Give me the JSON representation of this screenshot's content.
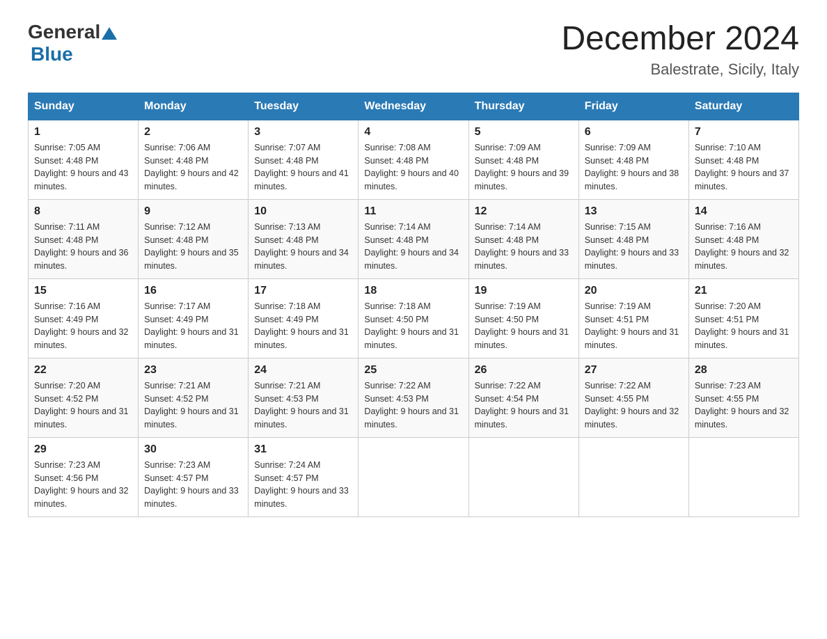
{
  "header": {
    "logo_general": "General",
    "logo_blue": "Blue",
    "month_title": "December 2024",
    "location": "Balestrate, Sicily, Italy"
  },
  "days_of_week": [
    "Sunday",
    "Monday",
    "Tuesday",
    "Wednesday",
    "Thursday",
    "Friday",
    "Saturday"
  ],
  "weeks": [
    [
      {
        "day": "1",
        "sunrise": "7:05 AM",
        "sunset": "4:48 PM",
        "daylight": "9 hours and 43 minutes."
      },
      {
        "day": "2",
        "sunrise": "7:06 AM",
        "sunset": "4:48 PM",
        "daylight": "9 hours and 42 minutes."
      },
      {
        "day": "3",
        "sunrise": "7:07 AM",
        "sunset": "4:48 PM",
        "daylight": "9 hours and 41 minutes."
      },
      {
        "day": "4",
        "sunrise": "7:08 AM",
        "sunset": "4:48 PM",
        "daylight": "9 hours and 40 minutes."
      },
      {
        "day": "5",
        "sunrise": "7:09 AM",
        "sunset": "4:48 PM",
        "daylight": "9 hours and 39 minutes."
      },
      {
        "day": "6",
        "sunrise": "7:09 AM",
        "sunset": "4:48 PM",
        "daylight": "9 hours and 38 minutes."
      },
      {
        "day": "7",
        "sunrise": "7:10 AM",
        "sunset": "4:48 PM",
        "daylight": "9 hours and 37 minutes."
      }
    ],
    [
      {
        "day": "8",
        "sunrise": "7:11 AM",
        "sunset": "4:48 PM",
        "daylight": "9 hours and 36 minutes."
      },
      {
        "day": "9",
        "sunrise": "7:12 AM",
        "sunset": "4:48 PM",
        "daylight": "9 hours and 35 minutes."
      },
      {
        "day": "10",
        "sunrise": "7:13 AM",
        "sunset": "4:48 PM",
        "daylight": "9 hours and 34 minutes."
      },
      {
        "day": "11",
        "sunrise": "7:14 AM",
        "sunset": "4:48 PM",
        "daylight": "9 hours and 34 minutes."
      },
      {
        "day": "12",
        "sunrise": "7:14 AM",
        "sunset": "4:48 PM",
        "daylight": "9 hours and 33 minutes."
      },
      {
        "day": "13",
        "sunrise": "7:15 AM",
        "sunset": "4:48 PM",
        "daylight": "9 hours and 33 minutes."
      },
      {
        "day": "14",
        "sunrise": "7:16 AM",
        "sunset": "4:48 PM",
        "daylight": "9 hours and 32 minutes."
      }
    ],
    [
      {
        "day": "15",
        "sunrise": "7:16 AM",
        "sunset": "4:49 PM",
        "daylight": "9 hours and 32 minutes."
      },
      {
        "day": "16",
        "sunrise": "7:17 AM",
        "sunset": "4:49 PM",
        "daylight": "9 hours and 31 minutes."
      },
      {
        "day": "17",
        "sunrise": "7:18 AM",
        "sunset": "4:49 PM",
        "daylight": "9 hours and 31 minutes."
      },
      {
        "day": "18",
        "sunrise": "7:18 AM",
        "sunset": "4:50 PM",
        "daylight": "9 hours and 31 minutes."
      },
      {
        "day": "19",
        "sunrise": "7:19 AM",
        "sunset": "4:50 PM",
        "daylight": "9 hours and 31 minutes."
      },
      {
        "day": "20",
        "sunrise": "7:19 AM",
        "sunset": "4:51 PM",
        "daylight": "9 hours and 31 minutes."
      },
      {
        "day": "21",
        "sunrise": "7:20 AM",
        "sunset": "4:51 PM",
        "daylight": "9 hours and 31 minutes."
      }
    ],
    [
      {
        "day": "22",
        "sunrise": "7:20 AM",
        "sunset": "4:52 PM",
        "daylight": "9 hours and 31 minutes."
      },
      {
        "day": "23",
        "sunrise": "7:21 AM",
        "sunset": "4:52 PM",
        "daylight": "9 hours and 31 minutes."
      },
      {
        "day": "24",
        "sunrise": "7:21 AM",
        "sunset": "4:53 PM",
        "daylight": "9 hours and 31 minutes."
      },
      {
        "day": "25",
        "sunrise": "7:22 AM",
        "sunset": "4:53 PM",
        "daylight": "9 hours and 31 minutes."
      },
      {
        "day": "26",
        "sunrise": "7:22 AM",
        "sunset": "4:54 PM",
        "daylight": "9 hours and 31 minutes."
      },
      {
        "day": "27",
        "sunrise": "7:22 AM",
        "sunset": "4:55 PM",
        "daylight": "9 hours and 32 minutes."
      },
      {
        "day": "28",
        "sunrise": "7:23 AM",
        "sunset": "4:55 PM",
        "daylight": "9 hours and 32 minutes."
      }
    ],
    [
      {
        "day": "29",
        "sunrise": "7:23 AM",
        "sunset": "4:56 PM",
        "daylight": "9 hours and 32 minutes."
      },
      {
        "day": "30",
        "sunrise": "7:23 AM",
        "sunset": "4:57 PM",
        "daylight": "9 hours and 33 minutes."
      },
      {
        "day": "31",
        "sunrise": "7:24 AM",
        "sunset": "4:57 PM",
        "daylight": "9 hours and 33 minutes."
      },
      null,
      null,
      null,
      null
    ]
  ]
}
